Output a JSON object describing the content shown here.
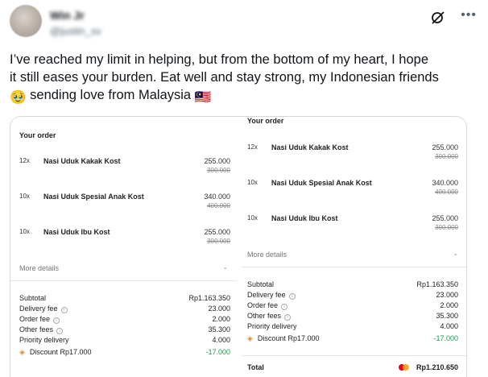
{
  "tweet": {
    "author_name": "Win Jr",
    "author_handle": "@justin_sv",
    "text_line1": "I’ve reached my limit in helping, but from the bottom of my heart, I hope",
    "text_line2": "it still eases your burden. Eat well and stay strong, my Indonesian friends",
    "text_line3": "sending love from Malaysia",
    "emoji_pleading": "🥹",
    "emoji_flag": "🇲🇾"
  },
  "receipt_left": {
    "title": "Your order",
    "items": [
      {
        "qty": "12x",
        "name": "Nasi Uduk Kakak Kost",
        "price": "255.000",
        "old_price": "300.000"
      },
      {
        "qty": "10x",
        "name": "Nasi Uduk Spesial Anak Kost",
        "price": "340.000",
        "old_price": "400.000"
      },
      {
        "qty": "10x",
        "name": "Nasi Uduk Ibu Kost",
        "price": "255.000",
        "old_price": "300.000"
      }
    ],
    "more_details": "More details",
    "summary": [
      {
        "label": "Subtotal",
        "value": "Rp1.163.350"
      },
      {
        "label": "Delivery fee",
        "value": "23.000"
      },
      {
        "label": "Order fee",
        "value": "2.000"
      },
      {
        "label": "Other fees",
        "value": "35.300"
      },
      {
        "label": "Priority delivery",
        "value": "4.000"
      },
      {
        "label": "Discount Rp17.000",
        "value": "-17.000"
      }
    ]
  },
  "receipt_right": {
    "title": "Your order",
    "items": [
      {
        "qty": "12x",
        "name": "Nasi Uduk Kakak Kost",
        "price": "255.000",
        "old_price": "300.000"
      },
      {
        "qty": "10x",
        "name": "Nasi Uduk Spesial Anak Kost",
        "price": "340.000",
        "old_price": "400.000"
      },
      {
        "qty": "10x",
        "name": "Nasi Uduk Ibu Kost",
        "price": "255.000",
        "old_price": "300.000"
      }
    ],
    "more_details": "More details",
    "summary": [
      {
        "label": "Subtotal",
        "value": "Rp1.163.350"
      },
      {
        "label": "Delivery fee",
        "value": "23.000"
      },
      {
        "label": "Order fee",
        "value": "2.000"
      },
      {
        "label": "Other fees",
        "value": "35.300"
      },
      {
        "label": "Priority delivery",
        "value": "4.000"
      },
      {
        "label": "Discount Rp17.000",
        "value": "-17.000"
      }
    ],
    "total_label": "Total",
    "total_value": "Rp1.210.650"
  },
  "colors": {
    "discount_green": "#1a9a50",
    "tag_orange": "#e0892b"
  }
}
